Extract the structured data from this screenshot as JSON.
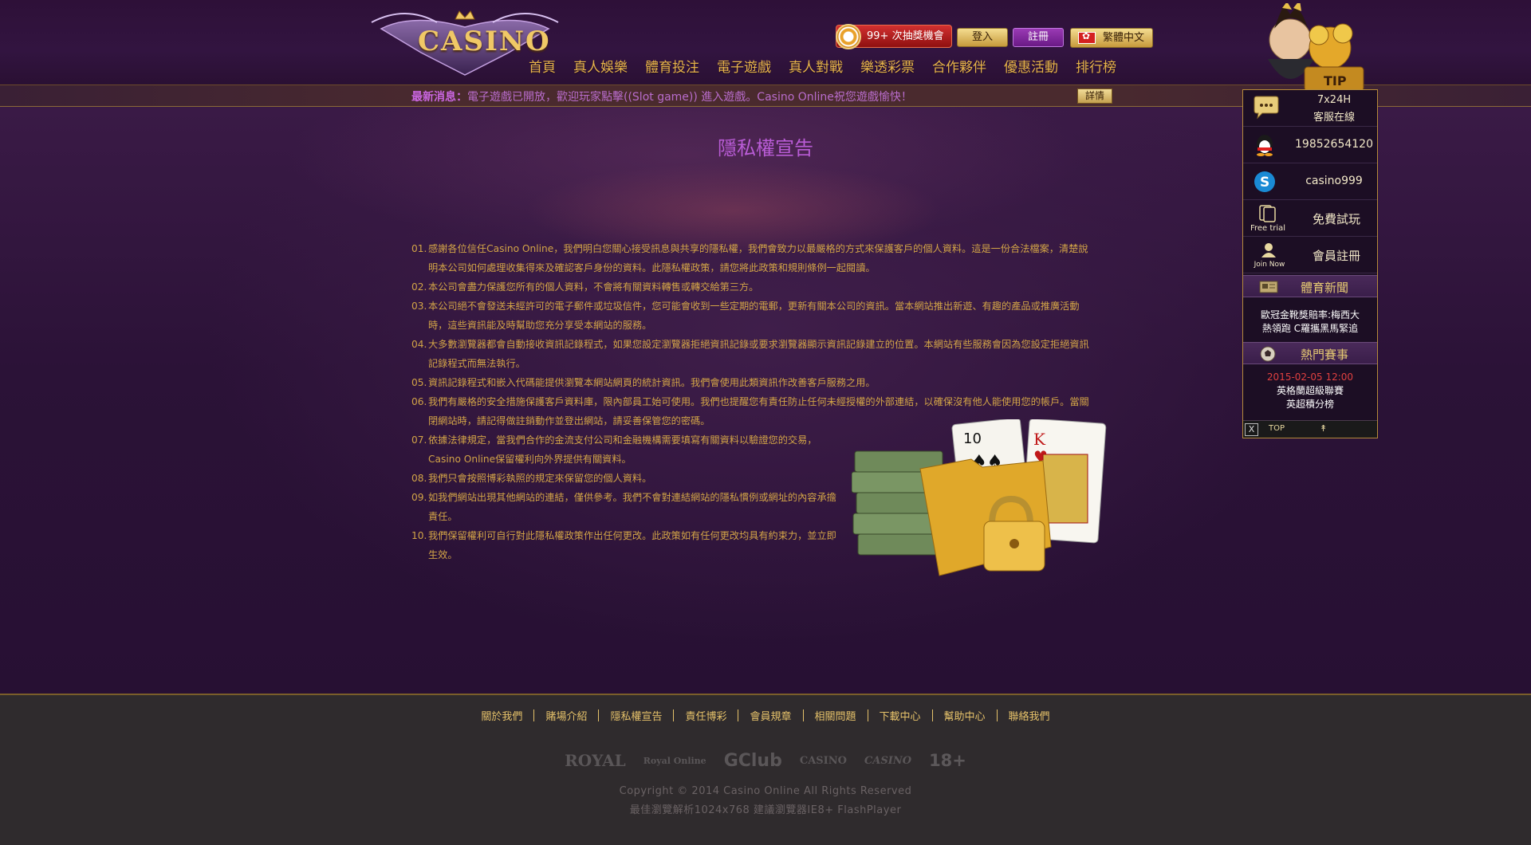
{
  "header": {
    "logo_text": "CASINO",
    "prize_label": "99+ 次抽獎機會",
    "login_label": "登入",
    "register_label": "註冊",
    "language_label": "繁體中文"
  },
  "nav": {
    "items": [
      "首頁",
      "真人娛樂",
      "體育投注",
      "電子遊戲",
      "真人對戰",
      "樂透彩票",
      "合作夥伴",
      "優惠活動",
      "排行榜"
    ]
  },
  "news": {
    "label": "最新消息：",
    "text": "電子遊戲已開放，歡迎玩家點擊((Slot game)) 進入遊戲。Casino Online祝您遊戲愉快！",
    "details_label": "詳情"
  },
  "main": {
    "title": "隱私權宣告",
    "items": [
      {
        "num": "01.",
        "text": "感謝各位信任Casino Online，我們明白您關心接受訊息與共享的隱私權，我們會致力以最嚴格的方式來保護客戶的個人資料。這是一份合法檔案，清楚說明本公司如何處理收集得來及確認客戶身份的資料。此隱私權政策，請您將此政策和規則條例一起閱讀。"
      },
      {
        "num": "02.",
        "text": "本公司會盡力保護您所有的個人資料，不會將有關資料轉售或轉交給第三方。"
      },
      {
        "num": "03.",
        "text": "本公司絕不會發送未經許可的電子郵件或垃圾信件，您可能會收到一些定期的電郵，更新有關本公司的資訊。當本網站推出新遊、有趣的產品或推廣活動時，這些資訊能及時幫助您充分享受本網站的服務。"
      },
      {
        "num": "04.",
        "text": "大多數瀏覽器都會自動接收資訊記錄程式，如果您設定瀏覽器拒絕資訊記錄或要求瀏覽器顯示資訊記錄建立的位置。本網站有些服務會因為您設定拒絕資訊記錄程式而無法執行。"
      },
      {
        "num": "05.",
        "text": "資訊記錄程式和嵌入代碼能提供瀏覽本網站網頁的統計資訊。我們會使用此類資訊作改善客戶服務之用。"
      },
      {
        "num": "06.",
        "text": "我們有嚴格的安全措施保護客戶資料庫，限內部員工始可使用。我們也提醒您有責任防止任何未經授權的外部連結，以確保沒有他人能使用您的帳戶。當關閉網站時，請記得做註銷動作並登出網站，請妥善保管您的密碼。"
      },
      {
        "num": "07.",
        "text": "依據法律規定，當我們合作的金流支付公司和金融機構需要填寫有關資料以驗證您的交易，Casino Online保留權利向外界提供有關資料。"
      },
      {
        "num": "08.",
        "text": "我們只會按照博彩執照的規定來保留您的個人資料。"
      },
      {
        "num": "09.",
        "text": "如我們網站出現其他網站的連結，僅供參考。我們不會對連結網站的隱私慣例或網址的內容承擔責任。"
      },
      {
        "num": "10.",
        "text": "我們保留權利可自行對此隱私權政策作出任何更改。此政策如有任何更改均具有約束力，並立即生效。"
      }
    ]
  },
  "footer": {
    "links": [
      "關於我們",
      "賭場介紹",
      "隱私權宣告",
      "責任博彩",
      "會員規章",
      "相關問題",
      "下載中心",
      "幫助中心",
      "聯絡我們"
    ],
    "partners": [
      "ROYAL",
      "Royal Online",
      "GClub",
      "CASINO",
      "CASINO",
      "18+"
    ],
    "copyright": "Copyright © 2014 Casino Online All Rights Reserved",
    "resolution": "最佳瀏覽解析1024x768 建議瀏覽器IE8+ FlashPlayer"
  },
  "sidebar": {
    "tip_label": "TIP",
    "support_hours": "7x24H",
    "support_label": "客服在線",
    "qq_number": "19852654120",
    "skype_id": "casino999",
    "free_trial_caption": "Free trial",
    "free_trial_label": "免費試玩",
    "join_now_caption": "Join Now",
    "join_label": "會員註冊",
    "sports_news_title": "體育新聞",
    "sports_news_line1": "歐冠金靴獎賠率:梅西大",
    "sports_news_line2": "熱領跑 C羅攜黑馬緊追",
    "hot_events_title": "熱門賽事",
    "event_date": "2015-02-05 12:00",
    "event_league": "英格蘭超級聯賽",
    "event_desc": "英超積分榜",
    "close_label": "X",
    "top_label": "TOP",
    "up_arrow": "↟"
  }
}
